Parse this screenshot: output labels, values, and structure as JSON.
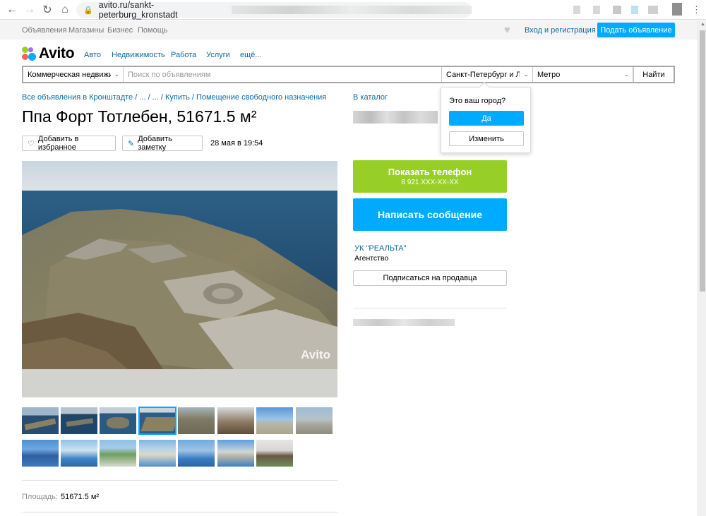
{
  "browser": {
    "url_text": "avito.ru/sankt-peterburg_kronstadt"
  },
  "topbar": {
    "links": [
      "Объявления",
      "Магазины",
      "Бизнес",
      "Помощь"
    ],
    "login": "Вход и регистрация",
    "post_button": "Подать объявление"
  },
  "logo": {
    "text": "Avito"
  },
  "categories": [
    "Авто",
    "Недвижимость",
    "Работа",
    "Услуги",
    "ещё..."
  ],
  "search": {
    "category": "Коммерческая недвижимость",
    "placeholder": "Поиск по объявлениям",
    "city": "Санкт-Петербург и Ленинградская область",
    "metro": "Метро",
    "find_button": "Найти"
  },
  "breadcrumbs": "Все объявления в Кронштадте / ... / ... / Купить / Помещение свободного назначения",
  "catalog_link": "В каталог",
  "title": "Ппа Форт Тотлебен, 51671.5 м²",
  "actions": {
    "favorite": "Добавить в избранное",
    "note": "Добавить заметку",
    "date": "28 мая в 19:54"
  },
  "photo": {
    "watermark": "Avito"
  },
  "details": {
    "area_label": "Площадь:",
    "area_value": "51671.5 м²"
  },
  "sidebar": {
    "phone_button": "Показать телефон",
    "phone_masked": "8 921 XXX-XX-XX",
    "message_button": "Написать сообщение",
    "seller_name": "УК \"РЕАЛЬТА\"",
    "seller_type": "Агентство",
    "subscribe_button": "Подписаться на продавца"
  },
  "city_popup": {
    "question": "Это ваш город?",
    "yes": "Да",
    "change": "Изменить"
  },
  "colors": {
    "accent": "#00aaff",
    "phone_green": "#97cf26",
    "link": "#0a6aa8"
  }
}
